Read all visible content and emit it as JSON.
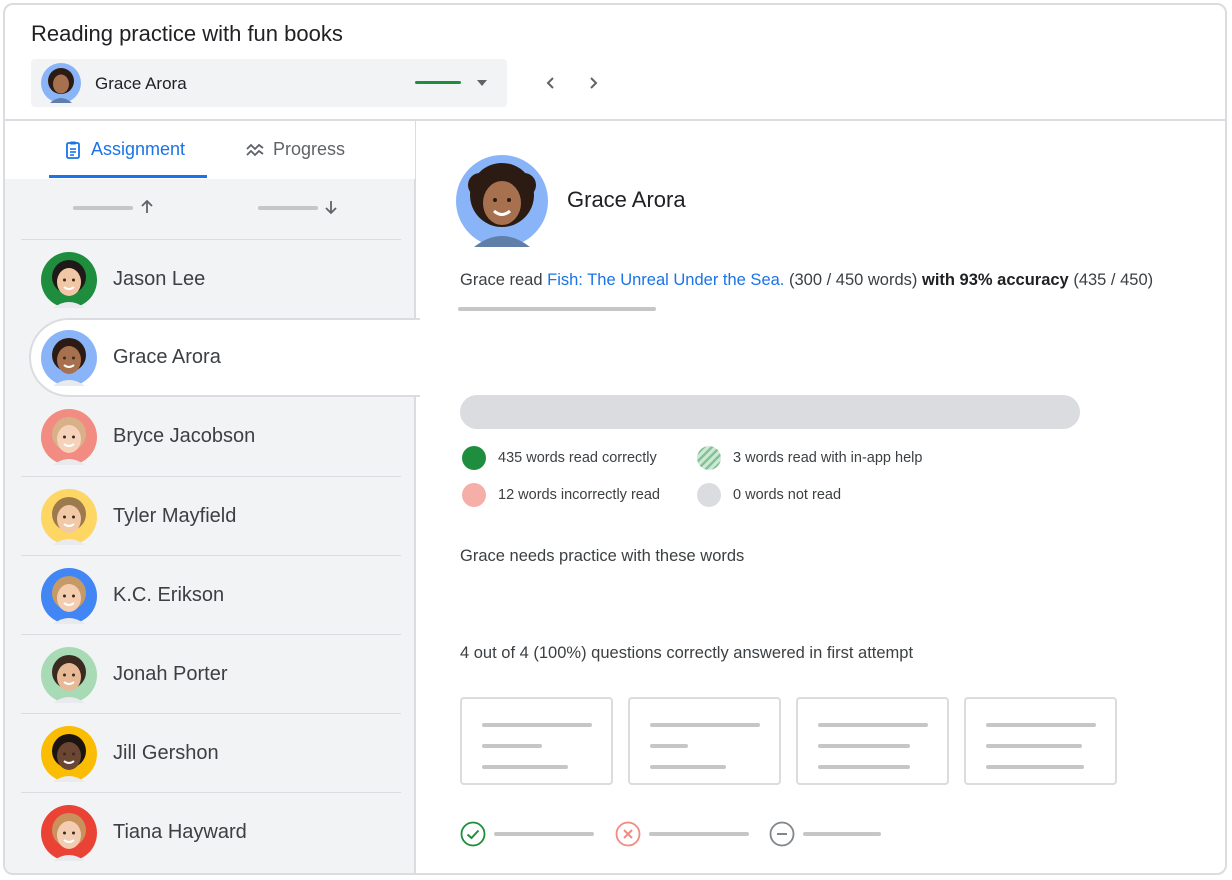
{
  "header": {
    "title": "Reading practice with fun books",
    "student_selector": {
      "value": "Grace Arora",
      "status_color": "#1e8e3e"
    }
  },
  "tabs": [
    {
      "label": "Assignment",
      "icon": "clipboard-icon",
      "active": true
    },
    {
      "label": "Progress",
      "icon": "trend-icon",
      "active": false
    }
  ],
  "students": [
    {
      "name": "Jason Lee",
      "ring": "#1e8e3e",
      "skin": "#f2c7a5",
      "hair": "#1f1a17"
    },
    {
      "name": "Grace Arora",
      "ring": "#8ab4f8",
      "skin": "#a7714f",
      "hair": "#2b1b12",
      "selected": true
    },
    {
      "name": "Bryce Jacobson",
      "ring": "#f28b82",
      "skin": "#f6d2bb",
      "hair": "#d9b189"
    },
    {
      "name": "Tyler Mayfield",
      "ring": "#fdd663",
      "skin": "#f1c9a6",
      "hair": "#9c7a4d"
    },
    {
      "name": "K.C. Erikson",
      "ring": "#4285f4",
      "skin": "#f4ccb0",
      "hair": "#c69a66"
    },
    {
      "name": "Jonah Porter",
      "ring": "#a8dab5",
      "skin": "#e8b996",
      "hair": "#3a2a1f"
    },
    {
      "name": "Jill Gershon",
      "ring": "#fbbc04",
      "skin": "#6b4632",
      "hair": "#1b1411"
    },
    {
      "name": "Tiana Hayward",
      "ring": "#ea4335",
      "skin": "#f3cdb2",
      "hair": "#c9925c"
    }
  ],
  "detail": {
    "name": "Grace Arora",
    "summary": {
      "prefix": "Grace read",
      "book": "Fish: The Unreal Under the Sea.",
      "words": "(300 / 450 words)",
      "accuracy": "with 93% accuracy",
      "accuracy_detail": "(435 / 450)"
    },
    "legend": [
      {
        "label": "435 words read correctly",
        "color": "#1e8e3e"
      },
      {
        "label": "3 words read with in-app help",
        "color": "#a8dab5",
        "pattern": "hatched"
      },
      {
        "label": "12 words incorrectly read",
        "color": "#f6aea9"
      },
      {
        "label": "0 words not read",
        "color": "#dadce0"
      }
    ],
    "practice_heading": "Grace needs practice with these words",
    "questions_heading": "4 out of 4 (100%) questions correctly answered in first attempt",
    "answer_key": [
      {
        "icon": "check-circle-icon",
        "color": "#1e8e3e"
      },
      {
        "icon": "x-circle-icon",
        "color": "#f28b82"
      },
      {
        "icon": "minus-circle-icon",
        "color": "#80868b"
      }
    ]
  },
  "colors": {
    "accent": "#1a73e8",
    "border": "#dadce0",
    "panel": "#f1f3f4"
  }
}
